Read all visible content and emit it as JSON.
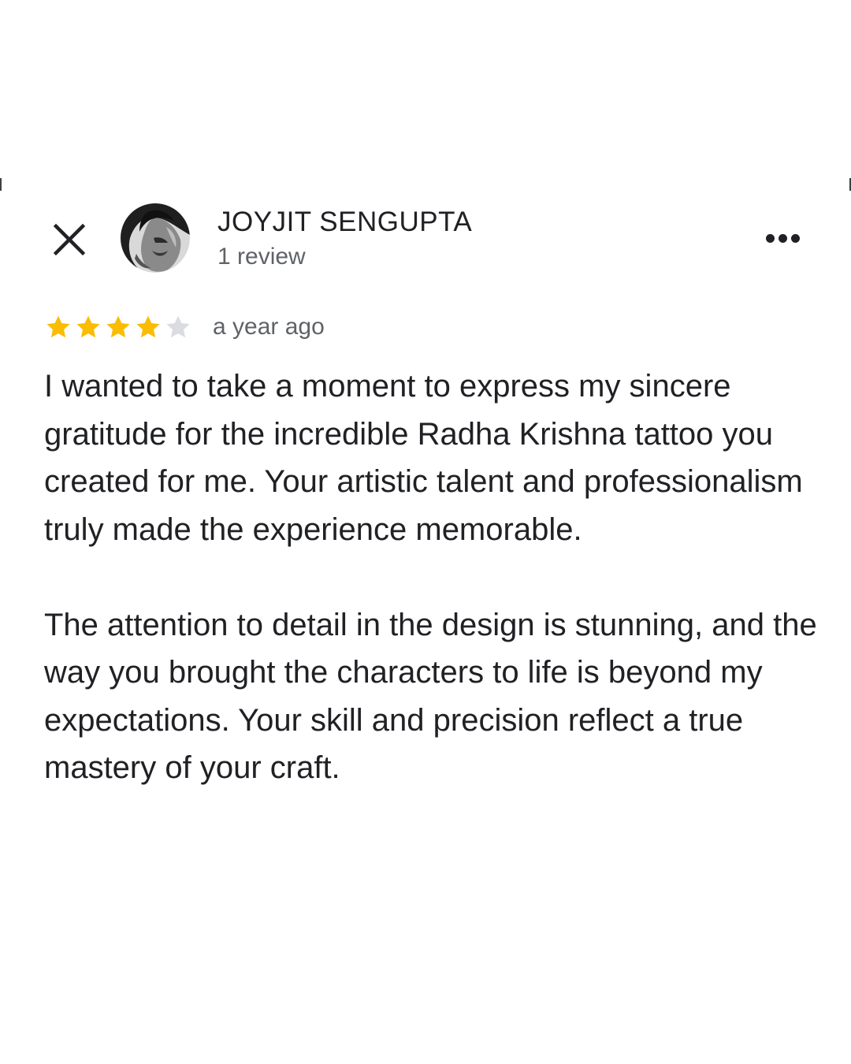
{
  "review": {
    "reviewer_name": "JOYJIT SENGUPTA",
    "review_count": "1 review",
    "rating": 4,
    "rating_max": 5,
    "age": "a year ago",
    "paragraphs": [
      "I wanted to take a moment to express my sincere gratitude for the incredible Radha Krishna tattoo you created for me. Your artistic talent and professionalism truly made the experience memorable.",
      "The attention to detail in the design is stunning, and the way you brought the characters to life is beyond my expectations. Your skill and precision reflect a true mastery of your craft."
    ]
  },
  "icons": {
    "close": "close-icon",
    "more": "more-horizontal-icon",
    "star": "star-icon"
  },
  "colors": {
    "star_filled": "#fbbc04",
    "star_empty": "#dadce0",
    "text_primary": "#202124",
    "text_secondary": "#5f6368"
  }
}
